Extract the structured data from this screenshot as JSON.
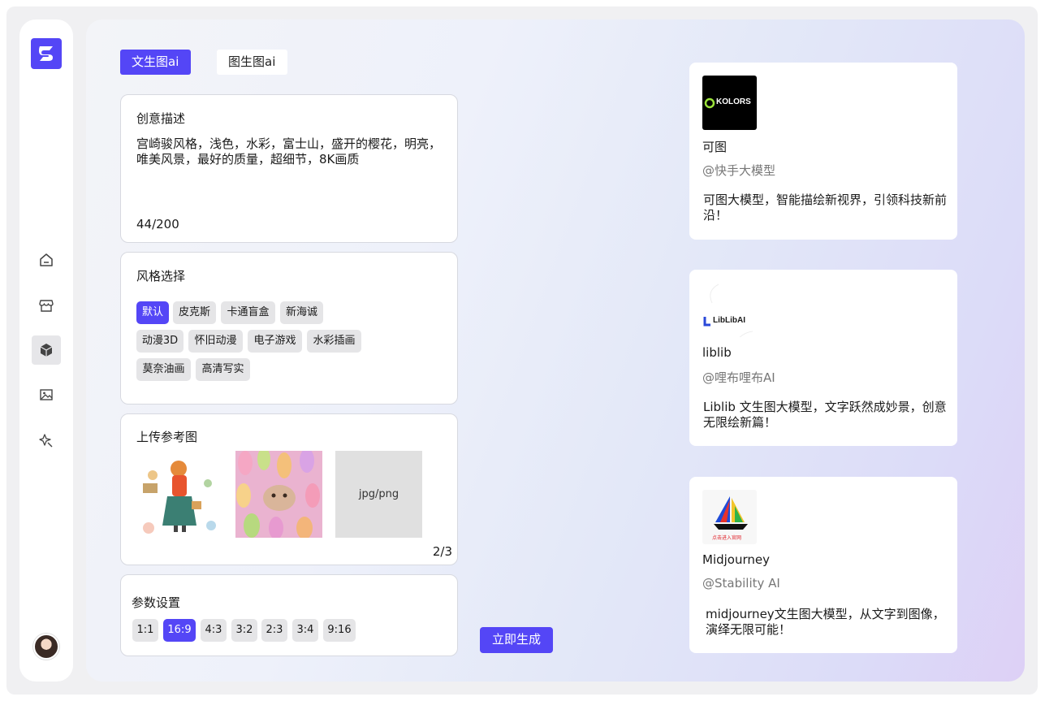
{
  "sidebar": {
    "logo": "app-logo",
    "nav": [
      {
        "icon": "home-icon",
        "active": false
      },
      {
        "icon": "store-icon",
        "active": false
      },
      {
        "icon": "cube-icon",
        "active": true
      },
      {
        "icon": "image-icon",
        "active": false
      },
      {
        "icon": "sparkle-icon",
        "active": false
      }
    ]
  },
  "tabs": [
    {
      "label": "文生图ai",
      "active": true
    },
    {
      "label": "图生图ai",
      "active": false
    }
  ],
  "description": {
    "title": "创意描述",
    "text": "宫崎骏风格，浅色，水彩，富士山，盛开的樱花，明亮，唯美风景，最好的质量，超细节，8K画质",
    "counter": "44/200"
  },
  "style": {
    "title": "风格选择",
    "options": [
      "默认",
      "皮克斯",
      "卡通盲盒",
      "新海诚",
      "动漫3D",
      "怀旧动漫",
      "电子游戏",
      "水彩插画",
      "莫奈油画",
      "高清写实"
    ],
    "selected": "默认"
  },
  "upload": {
    "title": "上传参考图",
    "slot_label": "jpg/png",
    "count": "2/3"
  },
  "params": {
    "title": "参数设置",
    "ratios": [
      "1:1",
      "16:9",
      "4:3",
      "3:2",
      "2:3",
      "3:4",
      "9:16"
    ],
    "selected": "16:9"
  },
  "generate_label": "立即生成",
  "models": [
    {
      "logo_text": "KOLORS",
      "name": "可图",
      "org": "@快手大模型",
      "desc": "可图大模型，智能描绘新视界，引领科技新前沿！"
    },
    {
      "logo_text": "LibLibAI",
      "name": "liblib",
      "org": "@哩布哩布AI",
      "desc": "Liblib 文生图大模型，文字跃然成妙景，创意无限绘新篇！"
    },
    {
      "logo_text": "点击进入官网",
      "name": "Midjourney",
      "org": "@Stability AI",
      "desc": "midjourney文生图大模型，从文字到图像，演绎无限可能！"
    }
  ],
  "colors": {
    "accent": "#5446f6",
    "chip_bg": "#e5e5e7",
    "panel_bg": "#ffffff"
  }
}
